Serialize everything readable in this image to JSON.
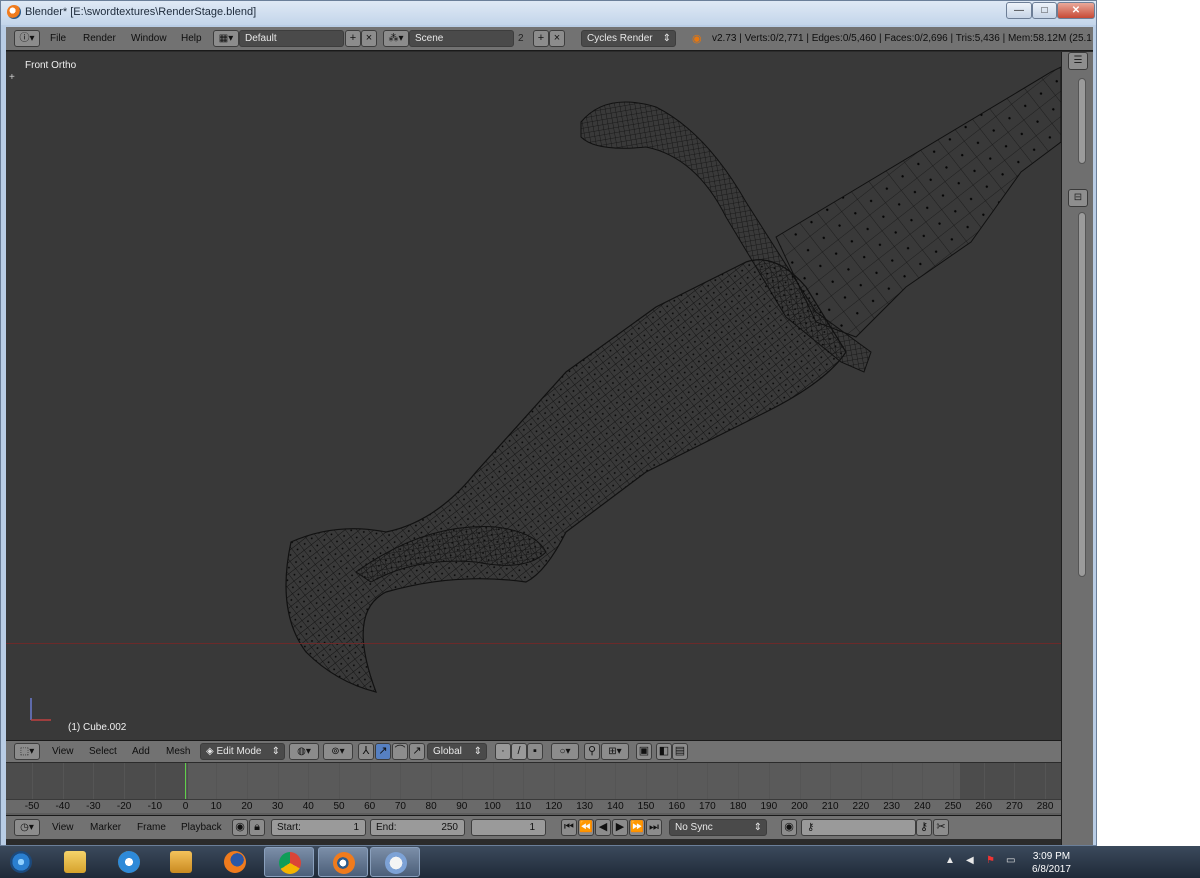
{
  "window": {
    "title": "Blender* [E:\\swordtextures\\RenderStage.blend]",
    "controls": {
      "minimize": "—",
      "maximize": "□",
      "close": "✕"
    }
  },
  "info_header": {
    "menus": [
      "File",
      "Render",
      "Window",
      "Help"
    ],
    "layout": "Default",
    "scene": "Scene",
    "scene_users": "2",
    "render_engine": "Cycles Render",
    "stats": "v2.73 | Verts:0/2,771 | Edges:0/5,460 | Faces:0/2,696 | Tris:5,436 | Mem:58.12M (25.1"
  },
  "viewport": {
    "view_name": "Front Ortho",
    "object_name": "(1) Cube.002",
    "toolshelf_toggle": "+"
  },
  "view3d_header": {
    "menus": [
      "View",
      "Select",
      "Add",
      "Mesh"
    ],
    "mode": "Edit Mode",
    "orientation": "Global"
  },
  "timeline": {
    "ruler_ticks": [
      "-50",
      "-40",
      "-30",
      "-20",
      "-10",
      "0",
      "10",
      "20",
      "30",
      "40",
      "50",
      "60",
      "70",
      "80",
      "90",
      "100",
      "110",
      "120",
      "130",
      "140",
      "150",
      "160",
      "170",
      "180",
      "190",
      "200",
      "210",
      "220",
      "230",
      "240",
      "250",
      "260",
      "270",
      "280"
    ],
    "current_frame_marker": 0,
    "menus": [
      "View",
      "Marker",
      "Frame",
      "Playback"
    ],
    "start_label": "Start:",
    "start_value": "1",
    "end_label": "End:",
    "end_value": "250",
    "current_frame": "1",
    "sync": "No Sync"
  },
  "taskbar": {
    "time": "3:09 PM",
    "date": "6/8/2017",
    "apps": [
      "start-orb",
      "file-explorer",
      "internet-explorer",
      "media-player",
      "firefox",
      "chrome",
      "blender",
      "paint"
    ]
  },
  "colors": {
    "viewport_bg": "#393939",
    "header_bg": "#727272",
    "mesh_wire": "#111111",
    "frame_cursor": "#60d04a"
  }
}
